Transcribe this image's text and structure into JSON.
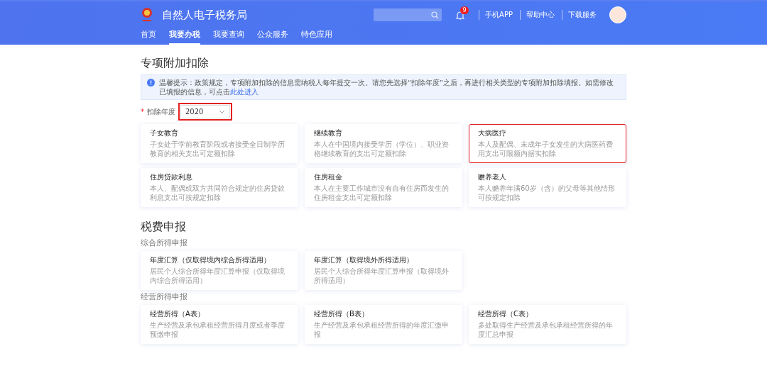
{
  "header": {
    "title": "自然人电子税务局",
    "notification_count": "9",
    "links": [
      "手机APP",
      "帮助中心",
      "下载服务"
    ]
  },
  "nav": [
    {
      "label": "首页",
      "selected": false
    },
    {
      "label": "我要办税",
      "selected": true
    },
    {
      "label": "我要查询",
      "selected": false
    },
    {
      "label": "公众服务",
      "selected": false
    },
    {
      "label": "特色应用",
      "selected": false
    }
  ],
  "deduction": {
    "title": "专项附加扣除",
    "notice": {
      "text": "温馨提示：政策规定，专项附加扣除的信息需纳税人每年提交一次。请您先选择“扣除年度”之后，再进行相关类型的专项附加扣除填报。如需修改已填报的信息，可点击",
      "link": "此处进入"
    },
    "year_select": {
      "label": "扣除年度",
      "required_mark": "*",
      "value": "2020",
      "highlighted": true
    },
    "cards": [
      {
        "title": "子女教育",
        "description": "子女处于学前教育阶段或者接受全日制学历教育的相关支出可定额扣除",
        "highlighted": false
      },
      {
        "title": "继续教育",
        "description": "本人在中国境内接受学历（学位）、职业资格继续教育的支出可定额扣除",
        "highlighted": false
      },
      {
        "title": "大病医疗",
        "description": "本人及配偶、未成年子女发生的大病医药费用支出可限额内据实扣除",
        "highlighted": true
      },
      {
        "title": "住房贷款利息",
        "description": "本人、配偶或双方共同符合规定的住房贷款利息支出可按规定扣除",
        "highlighted": false
      },
      {
        "title": "住房租金",
        "description": "本人在主要工作城市没有自有住房而发生的住房租金支出可定额扣除",
        "highlighted": false
      },
      {
        "title": "赡养老人",
        "description": "本人赡养年满60岁（含）的父母等其他情形可按规定扣除",
        "highlighted": false
      }
    ]
  },
  "filing": {
    "title": "税费申报",
    "groups": [
      {
        "title": "综合所得申报",
        "cards": [
          {
            "title": "年度汇算（仅取得境内综合所得适用）",
            "description": "居民个人综合所得年度汇算申报（仅取得境内综合所得适用）",
            "highlighted": false
          },
          {
            "title": "年度汇算（取得境外所得适用）",
            "description": "居民个人综合所得年度汇算申报（取得境外所得适用）",
            "highlighted": false
          }
        ]
      },
      {
        "title": "经营所得申报",
        "cards": [
          {
            "title": "经营所得（A表）",
            "description": "生产经营及承包承租经营所得月度或者季度预缴申报",
            "highlighted": false
          },
          {
            "title": "经营所得（B表）",
            "description": "生产经营及承包承租经营所得的年度汇缴申报",
            "highlighted": false
          },
          {
            "title": "经营所得（C表）",
            "description": "多处取得生产经营及承包承租经营所得的年度汇总申报",
            "highlighted": false
          }
        ]
      }
    ]
  }
}
